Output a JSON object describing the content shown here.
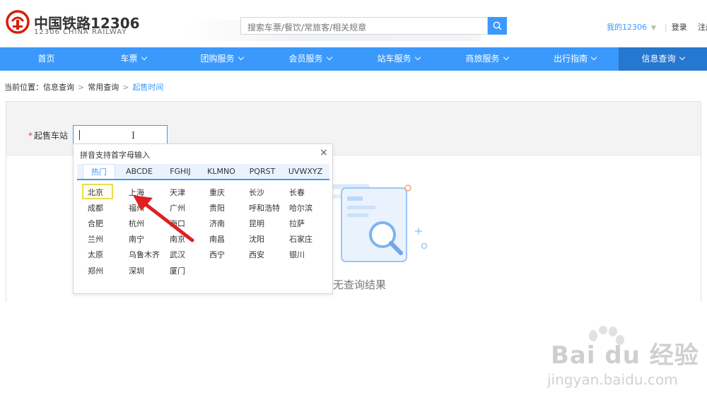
{
  "header": {
    "brand_cn": "中国铁路12306",
    "brand_en": "12306 CHINA RAILWAY",
    "search_placeholder": "搜索车票/餐饮/常旅客/相关规章",
    "my12306": "我的12306",
    "login": "登录",
    "register": "注册"
  },
  "nav": {
    "items": [
      {
        "label": "首页"
      },
      {
        "label": "车票"
      },
      {
        "label": "团购服务"
      },
      {
        "label": "会员服务"
      },
      {
        "label": "站车服务"
      },
      {
        "label": "商旅服务"
      },
      {
        "label": "出行指南"
      },
      {
        "label": "信息查询"
      }
    ]
  },
  "breadcrumb": {
    "prefix": "当前位置：",
    "items": [
      "信息查询",
      "常用查询",
      "起售时间"
    ],
    "separator": ">"
  },
  "form": {
    "required_mark": "*",
    "station_label": "起售车站",
    "station_value": "",
    "ibeam_glyph": "I"
  },
  "empty_state": {
    "text": "无查询结果"
  },
  "popup": {
    "hint": "拼音支持首字母输入",
    "close_glyph": "×",
    "tabs": [
      "热门",
      "ABCDE",
      "FGHIJ",
      "KLMNO",
      "PQRST",
      "UVWXYZ"
    ],
    "active_tab": "热门",
    "cities": [
      [
        "北京",
        "上海",
        "天津",
        "重庆",
        "长沙",
        "长春"
      ],
      [
        "成都",
        "福州",
        "广州",
        "贵阳",
        "呼和浩特",
        "哈尔滨"
      ],
      [
        "合肥",
        "杭州",
        "海口",
        "济南",
        "昆明",
        "拉萨"
      ],
      [
        "兰州",
        "南宁",
        "南京",
        "南昌",
        "沈阳",
        "石家庄"
      ],
      [
        "太原",
        "乌鲁木齐",
        "武汉",
        "西宁",
        "西安",
        "银川"
      ],
      [
        "郑州",
        "深圳",
        "厦门"
      ]
    ],
    "highlighted_city": "北京"
  },
  "watermark": {
    "main": "Bai du 经验",
    "sub": "jingyan.baidu.com"
  },
  "colors": {
    "brand_blue": "#3b99fc",
    "nav_active": "#2677cf",
    "logo_red": "#d81e06",
    "highlight_yellow": "#e6e04a",
    "arrow_red": "#e02020"
  },
  "icons": {
    "logo": "railway-logo-icon",
    "search": "search-icon",
    "dropdown": "caret-down-icon",
    "close": "close-icon",
    "annotation": "red-arrow-icon"
  }
}
